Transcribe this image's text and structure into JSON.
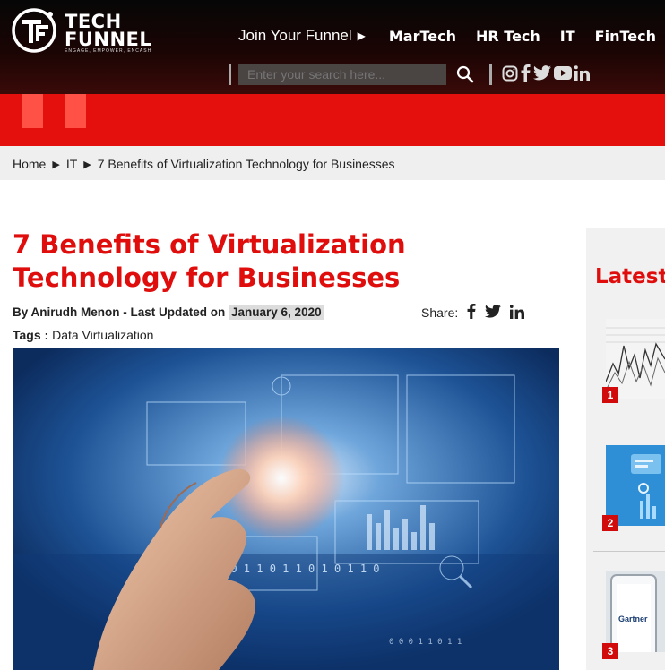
{
  "brand": {
    "name_line1": "TECH",
    "name_line2": "FUNNEL",
    "tagline": "ENGAGE, EMPOWER, ENCASH"
  },
  "topnav": {
    "join_label": "Join Your Funnel",
    "items": [
      "MarTech",
      "HR Tech",
      "IT",
      "FinTech"
    ]
  },
  "search": {
    "placeholder": "Enter your search here..."
  },
  "social": [
    "instagram-icon",
    "facebook-icon",
    "twitter-icon",
    "youtube-icon",
    "linkedin-icon"
  ],
  "breadcrumb": {
    "home": "Home",
    "category": "IT",
    "current": "7 Benefits of Virtualization Technology for Businesses"
  },
  "article": {
    "title": "7 Benefits of Virtualization Technology for Businesses",
    "byline_prefix": "By Anirudh Menon - Last Updated on",
    "date": "January 6, 2020",
    "share_label": "Share:",
    "tags_label": "Tags :",
    "tag": "Data Virtualization"
  },
  "sidebar": {
    "heading": "Latest",
    "items": [
      {
        "rank": "1"
      },
      {
        "rank": "2"
      },
      {
        "rank": "3",
        "logo_text": "Gartner"
      }
    ]
  },
  "colors": {
    "accent_red": "#e00d0d",
    "header_dark": "#060606",
    "band_red": "#e3100e"
  }
}
